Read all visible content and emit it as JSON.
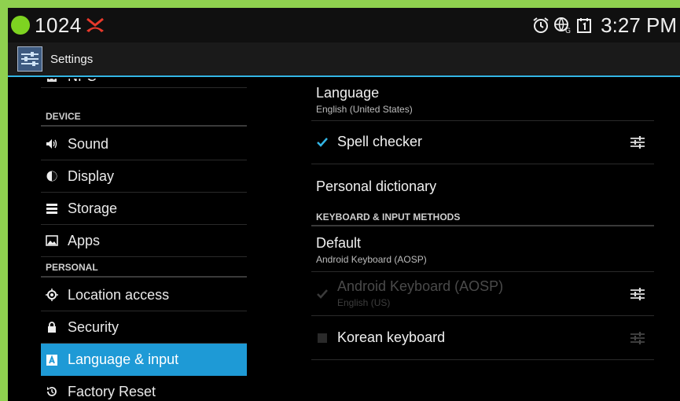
{
  "status_bar": {
    "number": "1024",
    "time": "3:27 PM"
  },
  "action_bar": {
    "title": "Settings"
  },
  "left_pane": {
    "partial_item": "NFC",
    "device_header": "DEVICE",
    "device_items": [
      "Sound",
      "Display",
      "Storage",
      "Apps"
    ],
    "personal_header": "PERSONAL",
    "personal_items": [
      "Location access",
      "Security",
      "Language & input",
      "Factory Reset"
    ],
    "selected": "Language & input"
  },
  "right_pane": {
    "language": {
      "title": "Language",
      "summary": "English (United States)"
    },
    "spell_checker": {
      "title": "Spell checker",
      "checked": true
    },
    "personal_dictionary": {
      "title": "Personal dictionary"
    },
    "keyboard_header": "KEYBOARD & INPUT METHODS",
    "default": {
      "title": "Default",
      "summary": "Android Keyboard (AOSP)"
    },
    "android_keyboard": {
      "title": "Android Keyboard (AOSP)",
      "summary": "English (US)",
      "checked": true,
      "enabled": false
    },
    "korean_keyboard": {
      "title": "Korean keyboard",
      "checked": false
    }
  },
  "colors": {
    "accent": "#33b5e5",
    "selected_bg": "#1e9ad6",
    "status_dot": "#7ed321",
    "missed_call": "#e8392b"
  }
}
